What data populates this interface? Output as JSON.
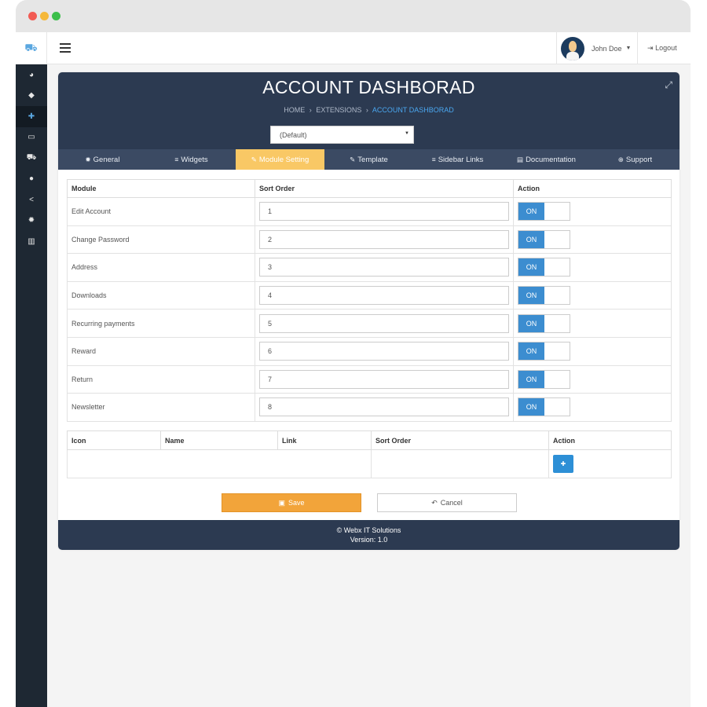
{
  "user": {
    "name": "John Doe",
    "logout_label": "Logout"
  },
  "sidebar": {
    "items": [
      {
        "icon": "dashboard-icon",
        "glyph": "◕"
      },
      {
        "icon": "tag-icon",
        "glyph": "◆"
      },
      {
        "icon": "puzzle-icon",
        "glyph": "✚",
        "active": true
      },
      {
        "icon": "desktop-icon",
        "glyph": "▭"
      },
      {
        "icon": "cart-icon",
        "glyph": "⛟"
      },
      {
        "icon": "user-icon",
        "glyph": "●"
      },
      {
        "icon": "share-icon",
        "glyph": "<"
      },
      {
        "icon": "gear-icon",
        "glyph": "✹"
      },
      {
        "icon": "bar-chart-icon",
        "glyph": "▥"
      }
    ]
  },
  "header": {
    "title": "ACCOUNT DASHBORAD",
    "breadcrumb": [
      "HOME",
      "EXTENSIONS",
      "ACCOUNT DASHBORAD"
    ],
    "breadcrumb_sep": "›",
    "store_select": "(Default)"
  },
  "tabs": [
    {
      "label": "General",
      "icon": "gear-icon",
      "glyph": "✹"
    },
    {
      "label": "Widgets",
      "icon": "list-icon",
      "glyph": "≡"
    },
    {
      "label": "Module Setting",
      "icon": "pencil-icon",
      "glyph": "✎",
      "active": true
    },
    {
      "label": "Template",
      "icon": "pencil-icon",
      "glyph": "✎"
    },
    {
      "label": "Sidebar Links",
      "icon": "list-icon",
      "glyph": "≡"
    },
    {
      "label": "Documentation",
      "icon": "file-icon",
      "glyph": "▤"
    },
    {
      "label": "Support",
      "icon": "lifebuoy-icon",
      "glyph": "⊕"
    }
  ],
  "modules": {
    "headers": [
      "Module",
      "Sort Order",
      "Action"
    ],
    "rows": [
      {
        "name": "Edit Account",
        "order": "1",
        "status": "ON"
      },
      {
        "name": "Change Password",
        "order": "2",
        "status": "ON"
      },
      {
        "name": "Address",
        "order": "3",
        "status": "ON"
      },
      {
        "name": "Downloads",
        "order": "4",
        "status": "ON"
      },
      {
        "name": "Recurring payments",
        "order": "5",
        "status": "ON"
      },
      {
        "name": "Reward",
        "order": "6",
        "status": "ON"
      },
      {
        "name": "Return",
        "order": "7",
        "status": "ON"
      },
      {
        "name": "Newsletter",
        "order": "8",
        "status": "ON"
      }
    ]
  },
  "links": {
    "headers": [
      "Icon",
      "Name",
      "Link",
      "Sort Order",
      "Action"
    ]
  },
  "buttons": {
    "save": "Save",
    "cancel": "Cancel"
  },
  "footer": {
    "copyright": "© Webx IT Solutions",
    "version": "Version: 1.0"
  },
  "colors": {
    "header_bg": "#2c3a51",
    "tab_active": "#f9c865",
    "toggle_on": "#3c8dd0",
    "save": "#f2a43a"
  }
}
